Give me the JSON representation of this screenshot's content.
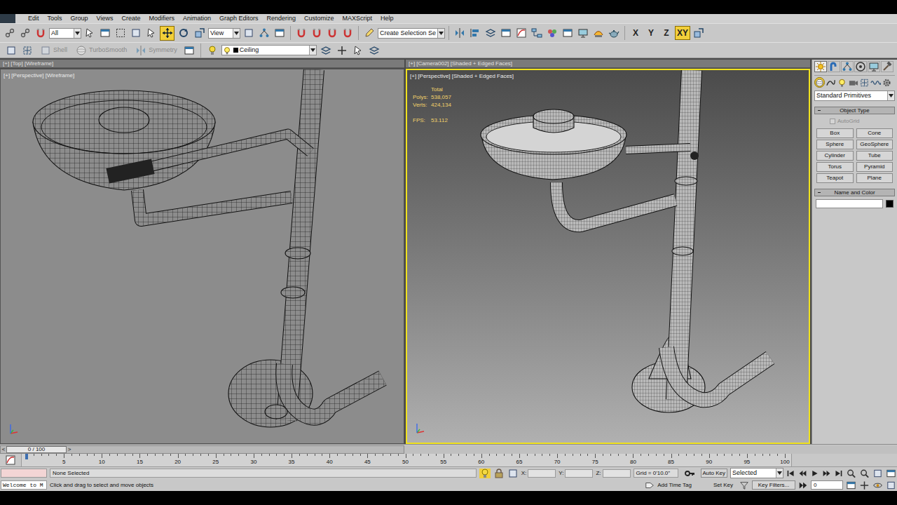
{
  "menu": [
    "Edit",
    "Tools",
    "Group",
    "Views",
    "Create",
    "Modifiers",
    "Animation",
    "Graph Editors",
    "Rendering",
    "Customize",
    "MAXScript",
    "Help"
  ],
  "main_toolbar": {
    "selection_filter": "All",
    "reference_coordinate": "View",
    "named_selection": "Create Selection Se",
    "transform_tools": [
      {
        "selected": true
      },
      {
        "selected": false
      },
      {
        "selected": false
      }
    ],
    "axis_constraints": [
      {
        "label": "X",
        "selected": false
      },
      {
        "label": "Y",
        "selected": false
      },
      {
        "label": "Z",
        "selected": false
      },
      {
        "label": "XY",
        "selected": true
      }
    ]
  },
  "ribbon": {
    "tools": [
      {
        "label": "Shell",
        "disabled": true
      },
      {
        "label": "TurboSmooth",
        "disabled": true
      },
      {
        "label": "Symmetry",
        "disabled": true
      }
    ],
    "layer": "Ceiling"
  },
  "viewports": [
    {
      "strip_label": "[+] [Top] [Wireframe]",
      "label": "[+] [Perspective] [Wireframe]",
      "active": false,
      "kind": "wireframe"
    },
    {
      "strip_label": "[+] [Camera002] [Shaded + Edged Faces]",
      "label": "[+] [Perspective] [Shaded + Edged Faces]",
      "active": true,
      "kind": "shaded"
    }
  ],
  "statistics": {
    "title": "Total",
    "rows": [
      {
        "label": "Polys:",
        "value": "538,057"
      },
      {
        "label": "Verts:",
        "value": "424,134"
      }
    ],
    "fps": {
      "label": "FPS:",
      "value": "53.112"
    }
  },
  "command_panel": {
    "tabs": [
      {
        "selected": true
      },
      {
        "selected": false
      },
      {
        "selected": false
      },
      {
        "selected": false
      },
      {
        "selected": false
      },
      {
        "selected": false
      }
    ],
    "subtabs": [
      {
        "selected": true
      },
      {
        "selected": false
      },
      {
        "selected": false
      },
      {
        "selected": false
      },
      {
        "selected": false
      },
      {
        "selected": false
      },
      {
        "selected": false
      }
    ],
    "category": "Standard Primitives",
    "object_type": {
      "title": "Object Type",
      "autogrid": {
        "label": "AutoGrid",
        "checked": false,
        "disabled": true
      },
      "buttons": [
        "Box",
        "Cone",
        "Sphere",
        "GeoSphere",
        "Cylinder",
        "Tube",
        "Torus",
        "Pyramid",
        "Teapot",
        "Plane"
      ]
    },
    "name_and_color": {
      "title": "Name and Color",
      "name": "",
      "color": "#000000"
    }
  },
  "time_slider": {
    "label": "0 / 100",
    "prev": "<",
    "next": ">"
  },
  "track_bar": {
    "ticks": [
      "5",
      "10",
      "15",
      "20",
      "25",
      "30",
      "35",
      "40",
      "45",
      "50",
      "55",
      "60",
      "65",
      "70",
      "75",
      "80",
      "85",
      "90",
      "95",
      "100"
    ]
  },
  "status": {
    "listener": "",
    "welcome": "Welcome to M",
    "selection": "None Selected",
    "prompt": "Click and drag to select and move objects",
    "coords": [
      {
        "label": "X:",
        "value": ""
      },
      {
        "label": "Y:",
        "value": ""
      },
      {
        "label": "Z:",
        "value": ""
      }
    ],
    "grid": "Grid = 0'10.0\"",
    "add_time_tag": "Add Time Tag",
    "auto_key": "Auto Key",
    "key_mode": "Selected",
    "set_key": "Set Key",
    "key_filters": "Key Filters...",
    "frame": "0"
  }
}
